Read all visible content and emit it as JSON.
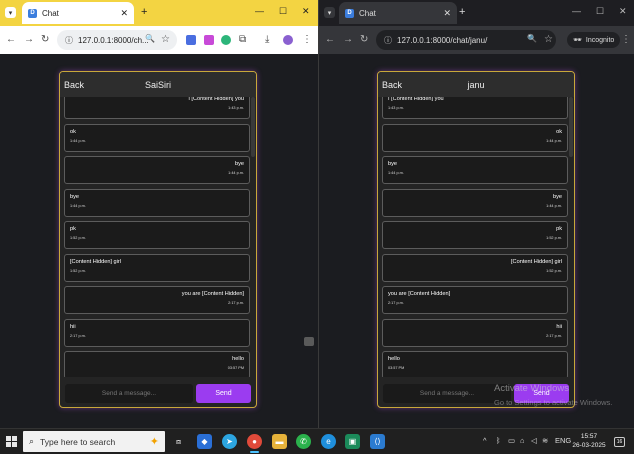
{
  "left_window": {
    "tab": {
      "title": "Chat"
    },
    "address": "127.0.0.1:8000/ch...",
    "chat": {
      "back_label": "Back",
      "title": "SaiSiri",
      "messages": [
        {
          "text": "I [Content Hidden] you",
          "time": "1:43 p.m.",
          "mine": true
        },
        {
          "text": "ok",
          "time": "1:44 p.m.",
          "mine": false
        },
        {
          "text": "bye",
          "time": "1:44 p.m.",
          "mine": true
        },
        {
          "text": "bye",
          "time": "1:44 p.m.",
          "mine": false
        },
        {
          "text": "pk",
          "time": "1:52 p.m.",
          "mine": false
        },
        {
          "text": "[Content Hidden] girl",
          "time": "1:52 p.m.",
          "mine": false
        },
        {
          "text": "you are [Content Hidden]",
          "time": "2:17 p.m.",
          "mine": true
        },
        {
          "text": "hii",
          "time": "2:17 p.m.",
          "mine": false
        },
        {
          "text": "hello",
          "time": "03:57 PM",
          "mine": true
        }
      ],
      "input_placeholder": "Send a message...",
      "send_label": "Send"
    }
  },
  "right_window": {
    "tab": {
      "title": "Chat"
    },
    "address": "127.0.0.1:8000/chat/janu/",
    "incognito_label": "Incognito",
    "chat": {
      "back_label": "Back",
      "title": "janu",
      "messages": [
        {
          "text": "I [Content Hidden] you",
          "time": "1:43 p.m.",
          "mine": false
        },
        {
          "text": "ok",
          "time": "1:44 p.m.",
          "mine": true
        },
        {
          "text": "bye",
          "time": "1:44 p.m.",
          "mine": false
        },
        {
          "text": "bye",
          "time": "1:44 p.m.",
          "mine": true
        },
        {
          "text": "pk",
          "time": "1:52 p.m.",
          "mine": true
        },
        {
          "text": "[Content Hidden] girl",
          "time": "1:52 p.m.",
          "mine": true
        },
        {
          "text": "you are [Content Hidden]",
          "time": "2:17 p.m.",
          "mine": false
        },
        {
          "text": "hii",
          "time": "2:17 p.m.",
          "mine": true
        },
        {
          "text": "hello",
          "time": "03:57 PM",
          "mine": false
        }
      ],
      "input_placeholder": "Send a message...",
      "send_label": "Send"
    }
  },
  "watermark": {
    "title": "Activate Windows",
    "subtitle": "Go to Settings to activate Windows."
  },
  "taskbar": {
    "search_placeholder": "Type here to search",
    "language": "ENG",
    "time": "15:57",
    "date": "26-03-2025",
    "notification_count": "16"
  },
  "colors": {
    "left_tabbar": "#f3d442",
    "send_button": "#9b3cf0",
    "chat_border": "#c8a83a"
  }
}
